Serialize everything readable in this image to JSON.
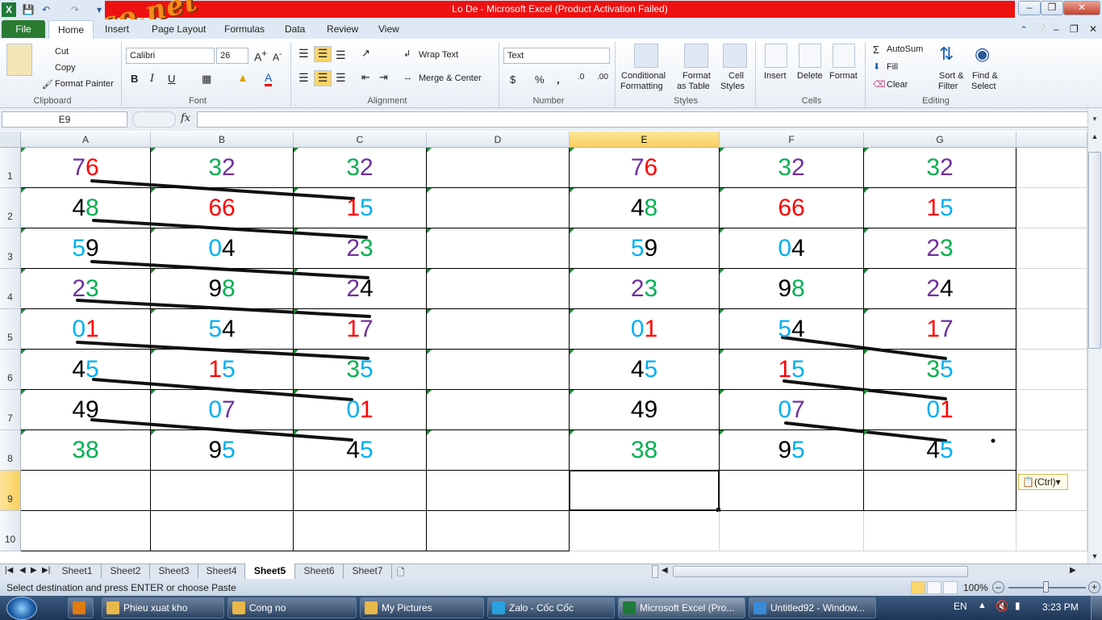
{
  "window": {
    "title": "Lo De  -  Microsoft Excel (Product Activation Failed)"
  },
  "watermark": "webxoso.net",
  "tabs": [
    "File",
    "Home",
    "Insert",
    "Page Layout",
    "Formulas",
    "Data",
    "Review",
    "View"
  ],
  "ribbon": {
    "clipboard": {
      "cut": "Cut",
      "copy": "Copy",
      "format_painter": "Format Painter",
      "label": "Clipboard"
    },
    "font": {
      "name": "Calibri",
      "size": "26",
      "label": "Font"
    },
    "alignment": {
      "wrap": "Wrap Text",
      "merge": "Merge & Center",
      "label": "Alignment"
    },
    "number": {
      "format": "Text",
      "label": "Number"
    },
    "styles": {
      "cond1": "Conditional",
      "cond2": "Formatting",
      "fat1": "Format",
      "fat2": "as Table",
      "cs1": "Cell",
      "cs2": "Styles",
      "label": "Styles"
    },
    "cells": {
      "insert": "Insert",
      "delete": "Delete",
      "format": "Format",
      "label": "Cells"
    },
    "editing": {
      "autosum": "AutoSum",
      "fill": "Fill",
      "clear": "Clear",
      "sort1": "Sort &",
      "sort2": "Filter",
      "find1": "Find &",
      "find2": "Select",
      "label": "Editing"
    }
  },
  "formula_bar": {
    "name_box": "E9",
    "fx": "fx",
    "value": ""
  },
  "columns": [
    "A",
    "B",
    "C",
    "D",
    "E",
    "F",
    "G"
  ],
  "rows": [
    "1",
    "2",
    "3",
    "4",
    "5",
    "6",
    "7",
    "8",
    "9",
    "10"
  ],
  "cells_left": [
    [
      [
        [
          "7",
          "#7030a0"
        ],
        [
          "6",
          "#ff0000"
        ]
      ],
      [
        [
          "3",
          "#00b050"
        ],
        [
          "2",
          "#7030a0"
        ]
      ],
      [
        [
          "3",
          "#00b050"
        ],
        [
          "2",
          "#7030a0"
        ]
      ]
    ],
    [
      [
        [
          "4",
          "#000000"
        ],
        [
          "8",
          "#00b050"
        ]
      ],
      [
        [
          "6",
          "#ff0000"
        ],
        [
          "6",
          "#ff0000"
        ]
      ],
      [
        [
          "1",
          "#ff0000"
        ],
        [
          "5",
          "#00b0f0"
        ]
      ]
    ],
    [
      [
        [
          "5",
          "#00b0f0"
        ],
        [
          "9",
          "#000000"
        ]
      ],
      [
        [
          "0",
          "#00b0f0"
        ],
        [
          "4",
          "#000000"
        ]
      ],
      [
        [
          "2",
          "#7030a0"
        ],
        [
          "3",
          "#00b050"
        ]
      ]
    ],
    [
      [
        [
          "2",
          "#7030a0"
        ],
        [
          "3",
          "#00b050"
        ]
      ],
      [
        [
          "9",
          "#000000"
        ],
        [
          "8",
          "#00b050"
        ]
      ],
      [
        [
          "2",
          "#7030a0"
        ],
        [
          "4",
          "#000000"
        ]
      ]
    ],
    [
      [
        [
          "0",
          "#00b0f0"
        ],
        [
          "1",
          "#ff0000"
        ]
      ],
      [
        [
          "5",
          "#00b0f0"
        ],
        [
          "4",
          "#000000"
        ]
      ],
      [
        [
          "1",
          "#ff0000"
        ],
        [
          "7",
          "#7030a0"
        ]
      ]
    ],
    [
      [
        [
          "4",
          "#000000"
        ],
        [
          "5",
          "#00b0f0"
        ]
      ],
      [
        [
          "1",
          "#ff0000"
        ],
        [
          "5",
          "#00b0f0"
        ]
      ],
      [
        [
          "3",
          "#00b050"
        ],
        [
          "5",
          "#00b0f0"
        ]
      ]
    ],
    [
      [
        [
          "4",
          "#000000"
        ],
        [
          "9",
          "#000000"
        ]
      ],
      [
        [
          "0",
          "#00b0f0"
        ],
        [
          "7",
          "#7030a0"
        ]
      ],
      [
        [
          "0",
          "#00b0f0"
        ],
        [
          "1",
          "#ff0000"
        ]
      ]
    ],
    [
      [
        [
          "3",
          "#00b050"
        ],
        [
          "8",
          "#00b050"
        ]
      ],
      [
        [
          "9",
          "#000000"
        ],
        [
          "5",
          "#00b0f0"
        ]
      ],
      [
        [
          "4",
          "#000000"
        ],
        [
          "5",
          "#00b0f0"
        ]
      ]
    ]
  ],
  "cells_right": [
    [
      [
        [
          "7",
          "#7030a0"
        ],
        [
          "6",
          "#ff0000"
        ]
      ],
      [
        [
          "3",
          "#00b050"
        ],
        [
          "2",
          "#7030a0"
        ]
      ],
      [
        [
          "3",
          "#00b050"
        ],
        [
          "2",
          "#7030a0"
        ]
      ]
    ],
    [
      [
        [
          "4",
          "#000000"
        ],
        [
          "8",
          "#00b050"
        ]
      ],
      [
        [
          "6",
          "#ff0000"
        ],
        [
          "6",
          "#ff0000"
        ]
      ],
      [
        [
          "1",
          "#ff0000"
        ],
        [
          "5",
          "#00b0f0"
        ]
      ]
    ],
    [
      [
        [
          "5",
          "#00b0f0"
        ],
        [
          "9",
          "#000000"
        ]
      ],
      [
        [
          "0",
          "#00b0f0"
        ],
        [
          "4",
          "#000000"
        ]
      ],
      [
        [
          "2",
          "#7030a0"
        ],
        [
          "3",
          "#00b050"
        ]
      ]
    ],
    [
      [
        [
          "2",
          "#7030a0"
        ],
        [
          "3",
          "#00b050"
        ]
      ],
      [
        [
          "9",
          "#000000"
        ],
        [
          "8",
          "#00b050"
        ]
      ],
      [
        [
          "2",
          "#7030a0"
        ],
        [
          "4",
          "#000000"
        ]
      ]
    ],
    [
      [
        [
          "0",
          "#00b0f0"
        ],
        [
          "1",
          "#ff0000"
        ]
      ],
      [
        [
          "5",
          "#00b0f0"
        ],
        [
          "4",
          "#000000"
        ]
      ],
      [
        [
          "1",
          "#ff0000"
        ],
        [
          "7",
          "#7030a0"
        ]
      ]
    ],
    [
      [
        [
          "4",
          "#000000"
        ],
        [
          "5",
          "#00b0f0"
        ]
      ],
      [
        [
          "1",
          "#ff0000"
        ],
        [
          "5",
          "#00b0f0"
        ]
      ],
      [
        [
          "3",
          "#00b050"
        ],
        [
          "5",
          "#00b0f0"
        ]
      ]
    ],
    [
      [
        [
          "4",
          "#000000"
        ],
        [
          "9",
          "#000000"
        ]
      ],
      [
        [
          "0",
          "#00b0f0"
        ],
        [
          "7",
          "#7030a0"
        ]
      ],
      [
        [
          "0",
          "#00b0f0"
        ],
        [
          "1",
          "#ff0000"
        ]
      ]
    ],
    [
      [
        [
          "3",
          "#00b050"
        ],
        [
          "8",
          "#00b050"
        ]
      ],
      [
        [
          "9",
          "#000000"
        ],
        [
          "5",
          "#00b0f0"
        ]
      ],
      [
        [
          "4",
          "#000000"
        ],
        [
          "5",
          "#00b0f0"
        ]
      ]
    ]
  ],
  "paste_options": "(Ctrl)",
  "sheets": [
    "Sheet1",
    "Sheet2",
    "Sheet3",
    "Sheet4",
    "Sheet5",
    "Sheet6",
    "Sheet7"
  ],
  "active_sheet": "Sheet5",
  "status": {
    "message": "Select destination and press ENTER or choose Paste",
    "zoom": "100%"
  },
  "taskbar": {
    "items": [
      "Phieu xuat kho",
      "Cong no",
      "My Pictures",
      "Zalo - Cốc Cốc",
      "Microsoft Excel (Pro...",
      "Untitled92 - Window..."
    ],
    "lang": "EN",
    "clock": "3:23 PM"
  }
}
